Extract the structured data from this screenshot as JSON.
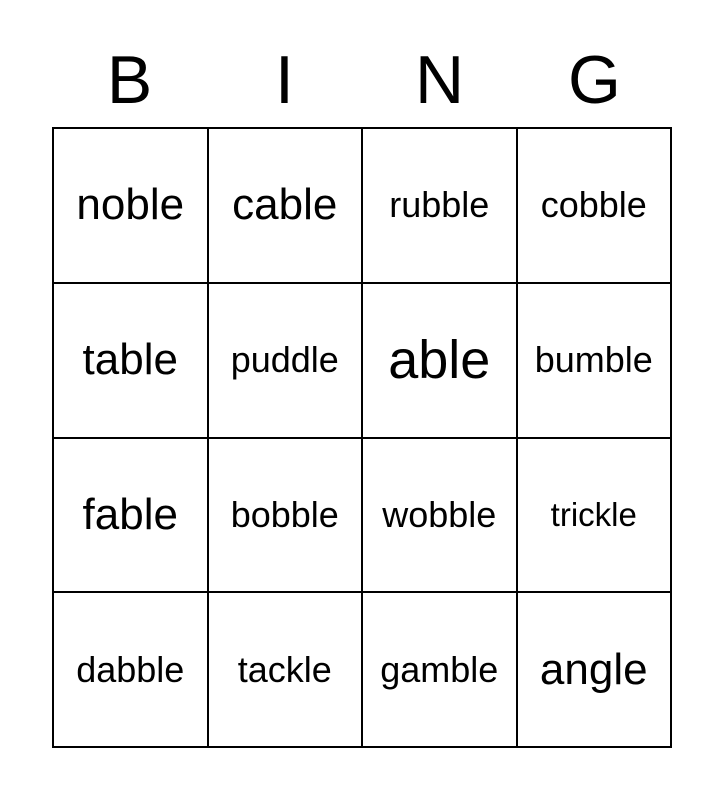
{
  "card": {
    "header_letters": [
      "B",
      "I",
      "N",
      "G"
    ],
    "columns": 4,
    "rows": 4,
    "colors": {
      "background": "#ffffff",
      "text": "#000000",
      "grid_line": "#000000"
    },
    "cells": [
      [
        {
          "word": "noble"
        },
        {
          "word": "cable"
        },
        {
          "word": "rubble"
        },
        {
          "word": "cobble"
        }
      ],
      [
        {
          "word": "table"
        },
        {
          "word": "puddle"
        },
        {
          "word": "able"
        },
        {
          "word": "bumble"
        }
      ],
      [
        {
          "word": "fable"
        },
        {
          "word": "bobble"
        },
        {
          "word": "wobble"
        },
        {
          "word": "trickle"
        }
      ],
      [
        {
          "word": "dabble"
        },
        {
          "word": "tackle"
        },
        {
          "word": "gamble"
        },
        {
          "word": "angle"
        }
      ]
    ]
  }
}
